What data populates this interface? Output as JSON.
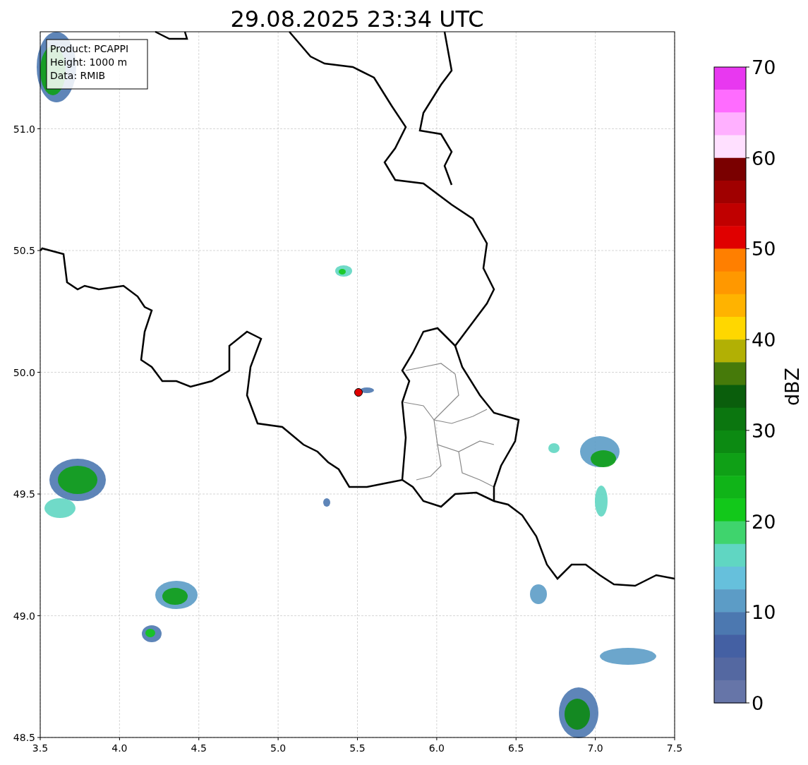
{
  "title": "29.08.2025 23:34 UTC",
  "info_box": [
    "Product: PCAPPI",
    "Height: 1000 m",
    "Data: RMIB"
  ],
  "x_ticks": [
    "3.5",
    "4.0",
    "4.5",
    "5.0",
    "5.5",
    "6.0",
    "6.5",
    "7.0",
    "7.5"
  ],
  "y_ticks": [
    "51.0",
    "50.5",
    "50.0",
    "49.5",
    "49.0",
    "48.5"
  ],
  "colorbar": {
    "label": "dBZ",
    "ticks": [
      "70",
      "60",
      "50",
      "40",
      "30",
      "20",
      "10",
      "0"
    ],
    "segments": [
      {
        "color": "#e838f0"
      },
      {
        "color": "#ff6cff"
      },
      {
        "color": "#ffb0ff"
      },
      {
        "color": "#ffe0ff"
      },
      {
        "color": "#7a0000"
      },
      {
        "color": "#a00000"
      },
      {
        "color": "#c00000"
      },
      {
        "color": "#e00000"
      },
      {
        "color": "#ff7f00"
      },
      {
        "color": "#ff9800"
      },
      {
        "color": "#ffb300"
      },
      {
        "color": "#ffd700"
      },
      {
        "color": "#b2b004"
      },
      {
        "color": "#467a0a"
      },
      {
        "color": "#0a5e0c"
      },
      {
        "color": "#0b760f"
      },
      {
        "color": "#0c8a12"
      },
      {
        "color": "#0fa016"
      },
      {
        "color": "#10b418"
      },
      {
        "color": "#12c81a"
      },
      {
        "color": "#3fd46d"
      },
      {
        "color": "#60d6c2"
      },
      {
        "color": "#66c0dc"
      },
      {
        "color": "#5c9cc6"
      },
      {
        "color": "#4c78b0"
      },
      {
        "color": "#4460a3"
      },
      {
        "color": "#5468a1"
      },
      {
        "color": "#6675a8"
      }
    ]
  }
}
